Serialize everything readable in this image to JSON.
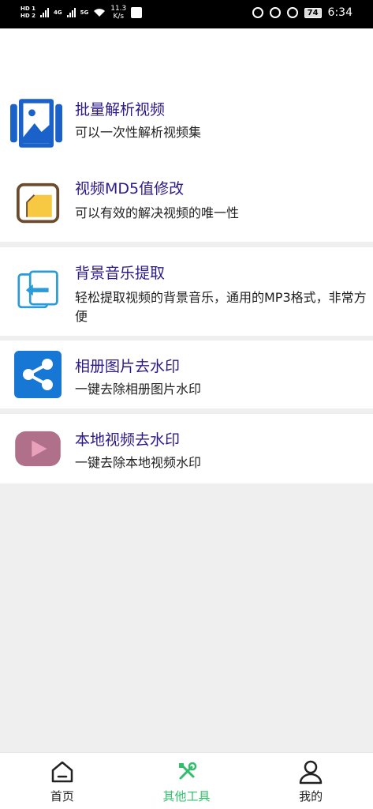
{
  "status_bar": {
    "hd1": "HD 1",
    "hd2": "HD 2",
    "net1": "4G",
    "net2": "5G",
    "speed_value": "11.3",
    "speed_unit": "K/s",
    "battery": "74",
    "time": "6:34"
  },
  "items": [
    {
      "title": "批量解析视频",
      "sub": "可以一次性解析视频集",
      "icon": "image-gallery-icon"
    },
    {
      "title": "视频MD5值修改",
      "sub": "可以有效的解决视频的唯一性",
      "icon": "folder-icon"
    },
    {
      "title": "背景音乐提取",
      "sub": "轻松提取视频的背景音乐，通用的MP3格式，非常方便",
      "icon": "extract-icon"
    },
    {
      "title": "相册图片去水印",
      "sub": "一键去除相册图片水印",
      "icon": "share-icon"
    },
    {
      "title": "本地视频去水印",
      "sub": "一键去除本地视频水印",
      "icon": "play-icon"
    }
  ],
  "tabs": [
    {
      "label": "首页",
      "icon": "home-icon"
    },
    {
      "label": "其他工具",
      "icon": "tools-icon"
    },
    {
      "label": "我的",
      "icon": "user-icon"
    }
  ],
  "colors": {
    "title": "#2b1a8c",
    "active_tab": "#2fbf6b",
    "background": "#efefef"
  }
}
